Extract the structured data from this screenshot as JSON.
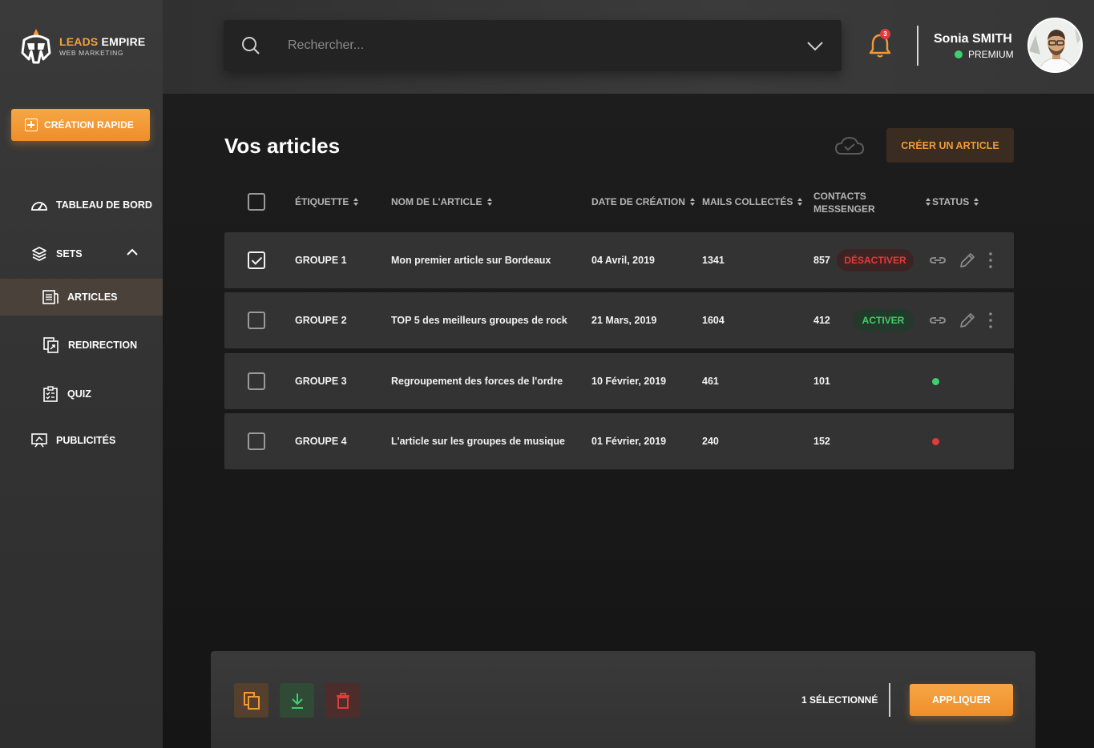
{
  "brand": {
    "name_accent": "LEADS",
    "name_main": "EMPIRE",
    "subtitle": "WEB MARKETING",
    "accent_color": "#F39A34"
  },
  "sidebar": {
    "quick_create_label": "CRÉATION RAPIDE",
    "items": [
      {
        "label": "TABLEAU DE BORD",
        "icon": "dashboard-gauge-icon"
      },
      {
        "label": "SETS",
        "icon": "layers-icon",
        "expanded": true
      },
      {
        "label": "ARTICLES",
        "icon": "article-icon",
        "active": true
      },
      {
        "label": "REDIRECTION",
        "icon": "redirect-icon"
      },
      {
        "label": "QUIZ",
        "icon": "quiz-clipboard-icon"
      },
      {
        "label": "PUBLICITÉS",
        "icon": "ads-icon"
      }
    ]
  },
  "header": {
    "search_placeholder": "Rechercher...",
    "notifications_count": "3",
    "user_name": "Sonia SMITH",
    "user_plan": "PREMIUM",
    "plan_status_color": "#3BD16F"
  },
  "main": {
    "title": "Vos articles",
    "create_button": "CRÉER UN ARTICLE",
    "columns": {
      "label": "ÉTIQUETTE",
      "name": "NOM DE L'ARTICLE",
      "date": "DATE DE CRÉATION",
      "mails": "MAILS COLLECTÉS",
      "contacts_line1": "CONTACTS",
      "contacts_line2": "MESSENGER",
      "status": "STATUS"
    },
    "rows": [
      {
        "label": "GROUPE 1",
        "name": "Mon premier article sur Bordeaux",
        "date": "04 Avril, 2019",
        "mails": "1341",
        "contacts": "857",
        "status_action": "DÉSACTIVER",
        "checked": true
      },
      {
        "label": "GROUPE 2",
        "name": "TOP 5 des meilleurs groupes de rock",
        "date": "21 Mars, 2019",
        "mails": "1604",
        "contacts": "412",
        "status_action": "ACTIVER",
        "checked": false
      },
      {
        "label": "GROUPE 3",
        "name": "Regroupement des forces de l'ordre",
        "date": "10 Février, 2019",
        "mails": "461",
        "contacts": "101",
        "status_color": "#3BD16F",
        "checked": false
      },
      {
        "label": "GROUPE 4",
        "name": "L'article sur les groupes de musique",
        "date": "01 Février, 2019",
        "mails": "240",
        "contacts": "152",
        "status_color": "#E23B3B",
        "checked": false
      }
    ]
  },
  "footer": {
    "selected_text": "1 SÉLECTIONNÉ",
    "apply_label": "APPLIQUER"
  }
}
